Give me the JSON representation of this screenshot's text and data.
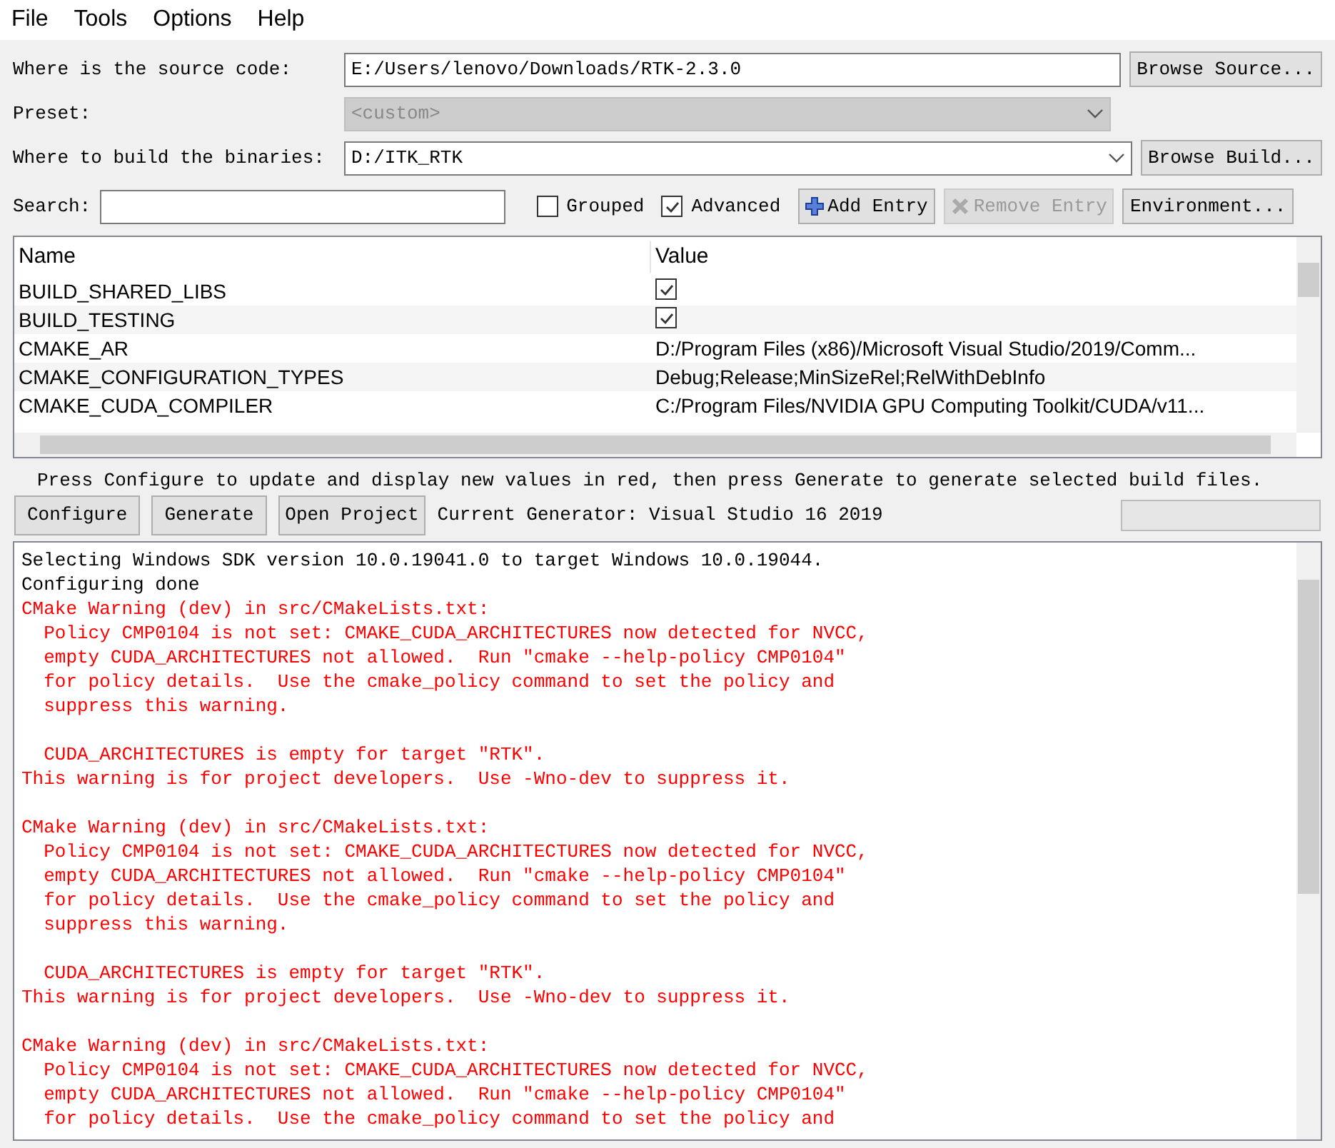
{
  "menu": [
    {
      "label": "File"
    },
    {
      "label": "Tools"
    },
    {
      "label": "Options"
    },
    {
      "label": "Help"
    }
  ],
  "source": {
    "label": "Where is the source code:",
    "value": "E:/Users/lenovo/Downloads/RTK-2.3.0",
    "button": "Browse Source..."
  },
  "preset": {
    "label": "Preset:",
    "value": "<custom>",
    "disabled": true
  },
  "build": {
    "label": "Where to build the binaries:",
    "value": "D:/ITK_RTK",
    "button": "Browse Build..."
  },
  "search": {
    "label": "Search:"
  },
  "options": [
    {
      "label": "Grouped",
      "checked": false
    },
    {
      "label": "Advanced",
      "checked": true
    }
  ],
  "entry_buttons": [
    {
      "label": "Add Entry",
      "kind": "add",
      "disabled": false
    },
    {
      "label": "Remove Entry",
      "kind": "remove",
      "disabled": true
    },
    {
      "label": "Environment...",
      "kind": "plain",
      "disabled": false
    }
  ],
  "table": {
    "columns": [
      "Name",
      "Value"
    ],
    "rows": [
      {
        "name": "BUILD_SHARED_LIBS",
        "kind": "checkbox",
        "checked": true
      },
      {
        "name": "BUILD_TESTING",
        "kind": "checkbox",
        "checked": true
      },
      {
        "name": "CMAKE_AR",
        "kind": "text",
        "value": "D:/Program Files (x86)/Microsoft Visual Studio/2019/Comm..."
      },
      {
        "name": "CMAKE_CONFIGURATION_TYPES",
        "kind": "text",
        "value": "Debug;Release;MinSizeRel;RelWithDebInfo"
      },
      {
        "name": "CMAKE_CUDA_COMPILER",
        "kind": "text",
        "value": "C:/Program Files/NVIDIA GPU Computing Toolkit/CUDA/v11..."
      }
    ]
  },
  "hint": "Press Configure to update and display new values in red, then press Generate to generate selected build files.",
  "actions": [
    "Configure",
    "Generate",
    "Open Project"
  ],
  "generator": "Current Generator: Visual Studio 16 2019",
  "progress": {
    "level": 0
  },
  "output": [
    {
      "kind": "info",
      "text": "Selecting Windows SDK version 10.0.19041.0 to target Windows 10.0.19044."
    },
    {
      "kind": "info",
      "text": "Configuring done"
    },
    {
      "kind": "warning",
      "text": "CMake Warning (dev) in src/CMakeLists.txt:"
    },
    {
      "kind": "warning",
      "text": "  Policy CMP0104 is not set: CMAKE_CUDA_ARCHITECTURES now detected for NVCC,"
    },
    {
      "kind": "warning",
      "text": "  empty CUDA_ARCHITECTURES not allowed.  Run ″cmake --help-policy CMP0104″"
    },
    {
      "kind": "warning",
      "text": "  for policy details.  Use the cmake_policy command to set the policy and"
    },
    {
      "kind": "warning",
      "text": "  suppress this warning."
    },
    {
      "kind": "blank"
    },
    {
      "kind": "warning",
      "text": "  CUDA_ARCHITECTURES is empty for target ″RTK″."
    },
    {
      "kind": "warning",
      "text": "This warning is for project developers.  Use -Wno-dev to suppress it."
    },
    {
      "kind": "blank"
    },
    {
      "kind": "warning",
      "text": "CMake Warning (dev) in src/CMakeLists.txt:"
    },
    {
      "kind": "warning",
      "text": "  Policy CMP0104 is not set: CMAKE_CUDA_ARCHITECTURES now detected for NVCC,"
    },
    {
      "kind": "warning",
      "text": "  empty CUDA_ARCHITECTURES not allowed.  Run ″cmake --help-policy CMP0104″"
    },
    {
      "kind": "warning",
      "text": "  for policy details.  Use the cmake_policy command to set the policy and"
    },
    {
      "kind": "warning",
      "text": "  suppress this warning."
    },
    {
      "kind": "blank"
    },
    {
      "kind": "warning",
      "text": "  CUDA_ARCHITECTURES is empty for target ″RTK″."
    },
    {
      "kind": "warning",
      "text": "This warning is for project developers.  Use -Wno-dev to suppress it."
    },
    {
      "kind": "blank"
    },
    {
      "kind": "warning",
      "text": "CMake Warning (dev) in src/CMakeLists.txt:"
    },
    {
      "kind": "warning",
      "text": "  Policy CMP0104 is not set: CMAKE_CUDA_ARCHITECTURES now detected for NVCC,"
    },
    {
      "kind": "warning",
      "text": "  empty CUDA_ARCHITECTURES not allowed.  Run ″cmake --help-policy CMP0104″"
    },
    {
      "kind": "warning",
      "text": "  for policy details.  Use the cmake_policy command to set the policy and"
    }
  ]
}
